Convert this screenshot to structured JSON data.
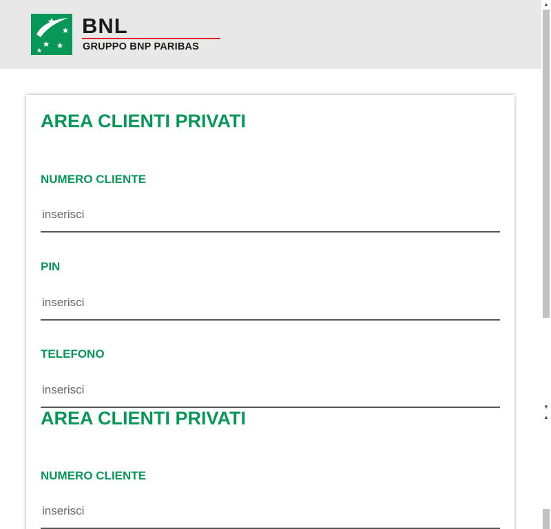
{
  "brand": {
    "name": "BNL",
    "group": "GRUPPO BNP PARIBAS"
  },
  "form_upper": {
    "title": "AREA CLIENTI PRIVATI",
    "fields": [
      {
        "label": "NUMERO CLIENTE",
        "placeholder": "inserisci"
      },
      {
        "label": "PIN",
        "placeholder": "inserisci"
      },
      {
        "label": "TELEFONO",
        "placeholder": "inserisci"
      }
    ]
  },
  "form_lower": {
    "title": "AREA CLIENTI PRIVATI",
    "fields": [
      {
        "label": "NUMERO CLIENTE",
        "placeholder": "inserisci"
      }
    ]
  },
  "icons": {
    "logo": "bnp-stars-icon",
    "scroll_up": "arrow-up-icon",
    "scroll_down": "arrow-down-icon"
  },
  "colors": {
    "brand_green": "#079858",
    "brand_red": "#e2231a",
    "header_bg": "#e8e8e8"
  }
}
